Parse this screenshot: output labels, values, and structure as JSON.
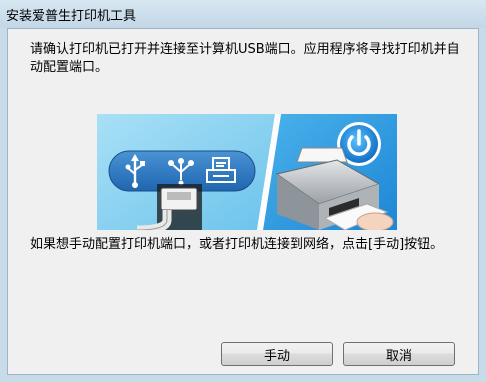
{
  "window": {
    "title": "安装爱普生打印机工具"
  },
  "content": {
    "instruction": "请确认打印机已打开并连接至计算机USB端口。应用程序将寻找打印机并自动配置端口。",
    "manual_hint": "如果想手动配置打印机端口，或者打印机连接到网络，点击[手动]按钮。"
  },
  "illustration": {
    "icons": [
      "usb-icon",
      "firewire-icon",
      "printer-port-icon",
      "power-icon"
    ],
    "colors": {
      "left_bg": "#8fd3f0",
      "right_bg": "#2a9ae0",
      "icon_pill": "#2f7fc6",
      "power_button": "#1e8be0"
    }
  },
  "buttons": {
    "manual_label": "手动",
    "cancel_label": "取消"
  }
}
